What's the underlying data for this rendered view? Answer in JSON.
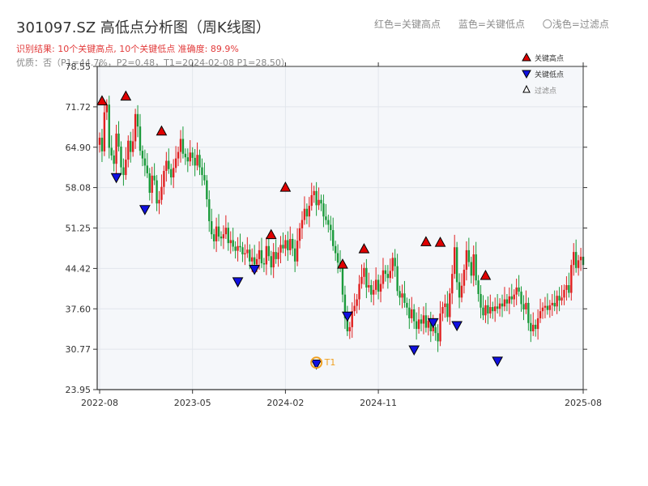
{
  "header": {
    "title": "301097.SZ 高低点分析图（周K线图）",
    "result_line": "识别结果: 10个关键高点, 10个关键低点  准确度: 89.9%",
    "quality_line": "优质：否（P1=44.7%，P2=0.48，T1=2024-02-08 P1=28.50）"
  },
  "top_legend": {
    "red": "红色=关键高点",
    "blue": "蓝色=关键低点",
    "light": "〇浅色=过滤点"
  },
  "legend": {
    "high": "关键高点",
    "low": "关键低点",
    "filtered": "过滤点"
  },
  "colors": {
    "up": "#e02020",
    "down": "#1a9a3a",
    "high_marker": "#e00000",
    "low_marker": "#1010e0",
    "t1_marker": "#f0a020",
    "plot_bg": "#f5f7fa"
  },
  "chart_data": {
    "type": "candlestick",
    "title": "301097.SZ 高低点分析图（周K线图）",
    "ylim": [
      23.95,
      78.55
    ],
    "y_ticks": [
      "23.95",
      "30.77",
      "37.60",
      "44.42",
      "51.25",
      "58.08",
      "64.90",
      "71.72",
      "78.55"
    ],
    "x_ticks": [
      "2022-08",
      "2023-05",
      "2024-02",
      "2024-11",
      "2025-08"
    ],
    "t1_label": "T1",
    "closes": [
      66.5,
      64.2,
      70.8,
      72.1,
      64.8,
      63.5,
      62.1,
      67.2,
      65.0,
      61.5,
      60.2,
      62.8,
      66.0,
      64.1,
      65.9,
      70.5,
      68.4,
      64.3,
      63.0,
      61.8,
      60.5,
      57.2,
      60.1,
      59.3,
      55.4,
      56.0,
      58.2,
      60.9,
      62.6,
      61.2,
      59.8,
      61.4,
      63.0,
      64.1,
      66.3,
      63.8,
      63.2,
      62.5,
      64.0,
      63.1,
      61.8,
      63.6,
      61.5,
      60.2,
      59.3,
      56.1,
      52.4,
      50.2,
      49.0,
      51.5,
      49.8,
      49.5,
      50.2,
      51.3,
      48.7,
      49.2,
      48.1,
      47.4,
      48.2,
      48.0,
      46.8,
      47.0,
      47.6,
      45.6,
      46.3,
      45.1,
      46.0,
      47.5,
      45.3,
      45.1,
      48.2,
      46.5,
      44.6,
      47.2,
      46.0,
      47.1,
      48.4,
      47.8,
      49.2,
      47.5,
      49.4,
      47.8,
      45.6,
      49.1,
      51.2,
      52.6,
      54.5,
      53.2,
      55.0,
      56.8,
      57.5,
      55.1,
      56.0,
      55.4,
      53.2,
      52.6,
      51.8,
      50.9,
      48.2,
      47.0,
      45.4,
      44.6,
      40.0,
      36.0,
      33.8,
      34.5,
      37.2,
      38.1,
      39.2,
      41.8,
      43.0,
      44.5,
      41.2,
      41.6,
      40.0,
      40.8,
      42.5,
      40.5,
      41.8,
      44.1,
      43.5,
      42.8,
      44.0,
      46.2,
      44.8,
      40.6,
      39.5,
      40.2,
      38.6,
      37.8,
      36.0,
      37.5,
      35.5,
      34.2,
      35.8,
      35.1,
      36.5,
      34.4,
      35.6,
      33.8,
      34.5,
      33.5,
      32.1,
      36.8,
      37.9,
      38.5,
      36.2,
      40.2,
      43.5,
      48.0,
      42.1,
      39.5,
      41.5,
      44.2,
      47.5,
      45.5,
      43.2,
      46.8,
      42.4,
      40.1,
      37.8,
      36.5,
      38.2,
      36.8,
      37.9,
      37.2,
      38.0,
      37.6,
      38.5,
      38.0,
      39.2,
      38.5,
      39.7,
      39.2,
      40.0,
      41.2,
      40.5,
      38.4,
      37.5,
      38.6,
      35.2,
      33.8,
      34.9,
      34.2,
      36.0,
      37.2,
      37.8,
      38.1,
      37.4,
      38.2,
      38.6,
      38.0,
      39.8,
      39.0,
      39.5,
      40.8,
      41.6,
      40.3,
      45.0,
      47.2,
      44.5,
      45.8,
      46.4,
      45.0
    ],
    "key_highs": [
      {
        "i": 1,
        "price": 72.6
      },
      {
        "i": 11,
        "price": 73.4
      },
      {
        "i": 26,
        "price": 67.5
      },
      {
        "i": 72,
        "price": 50.0
      },
      {
        "i": 78,
        "price": 58.0
      },
      {
        "i": 102,
        "price": 45.0
      },
      {
        "i": 111,
        "price": 47.6
      },
      {
        "i": 137,
        "price": 48.8
      },
      {
        "i": 143,
        "price": 48.7
      },
      {
        "i": 162,
        "price": 43.1
      }
    ],
    "key_lows": [
      {
        "i": 7,
        "price": 59.9
      },
      {
        "i": 19,
        "price": 54.5
      },
      {
        "i": 58,
        "price": 42.3
      },
      {
        "i": 65,
        "price": 44.4
      },
      {
        "i": 91,
        "price": 28.4
      },
      {
        "i": 104,
        "price": 36.5
      },
      {
        "i": 132,
        "price": 30.8
      },
      {
        "i": 140,
        "price": 35.4
      },
      {
        "i": 150,
        "price": 34.9
      },
      {
        "i": 167,
        "price": 28.9
      }
    ],
    "t1": {
      "i": 91,
      "price": 28.5,
      "date": "2024-02-08"
    }
  }
}
